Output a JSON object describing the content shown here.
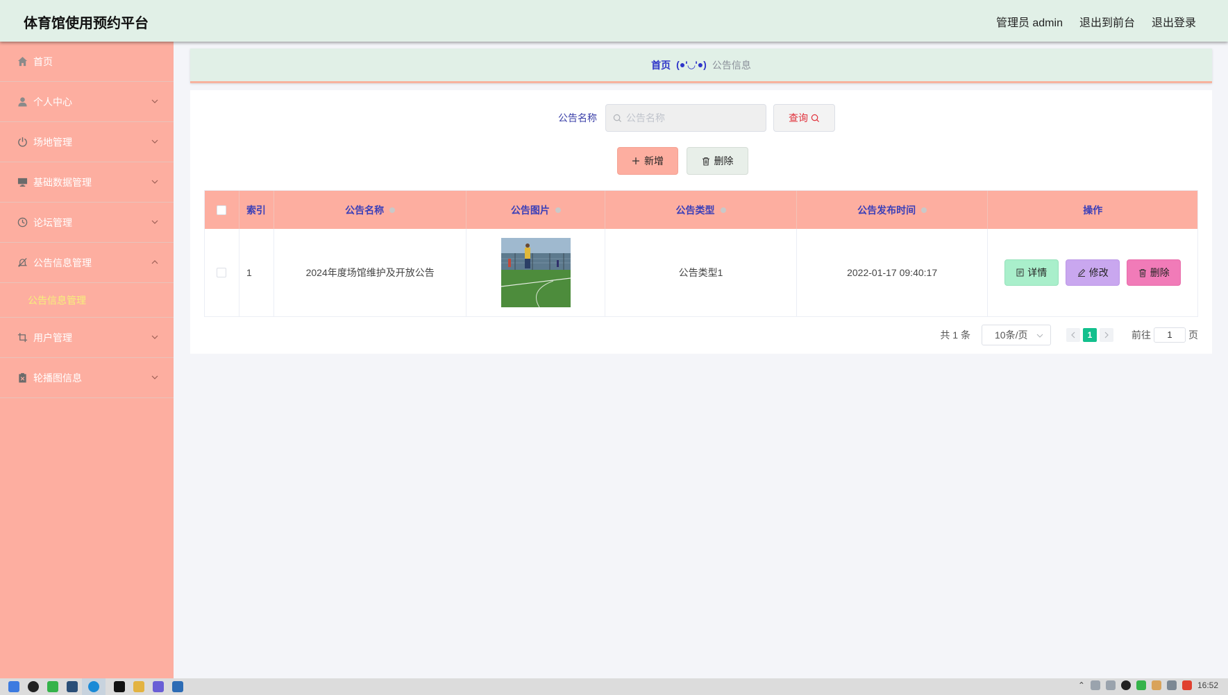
{
  "header": {
    "app_title": "体育馆使用预约平台",
    "admin_label": "管理员 admin",
    "to_frontend": "退出到前台",
    "logout": "退出登录"
  },
  "sidebar": {
    "items": [
      {
        "label": "首页",
        "icon": "home-icon"
      },
      {
        "label": "个人中心",
        "icon": "user-icon"
      },
      {
        "label": "场地管理",
        "icon": "power-icon"
      },
      {
        "label": "基础数据管理",
        "icon": "monitor-icon"
      },
      {
        "label": "论坛管理",
        "icon": "clock-icon"
      },
      {
        "label": "公告信息管理",
        "icon": "bell-off-icon"
      },
      {
        "label": "用户管理",
        "icon": "crop-icon"
      },
      {
        "label": "轮播图信息",
        "icon": "clipboard-icon"
      }
    ],
    "active_sub": "公告信息管理"
  },
  "breadcrumb": {
    "home": "首页",
    "emoji": "(●'◡'●)",
    "current": "公告信息"
  },
  "search": {
    "label": "公告名称",
    "placeholder": "公告名称",
    "query_label": "查询"
  },
  "actions": {
    "add_label": "新增",
    "delete_label": "删除"
  },
  "table": {
    "columns": [
      "索引",
      "公告名称",
      "公告图片",
      "公告类型",
      "公告发布时间",
      "操作"
    ],
    "rows": [
      {
        "index": "1",
        "name": "2024年度场馆维护及开放公告",
        "type": "公告类型1",
        "time": "2022-01-17 09:40:17"
      }
    ],
    "op_detail": "详情",
    "op_edit": "修改",
    "op_delete": "删除"
  },
  "pagination": {
    "total": "共 1 条",
    "page_size": "10条/页",
    "current_page": "1",
    "goto_label": "前往",
    "goto_value": "1",
    "page_suffix": "页"
  },
  "taskbar": {
    "clock": "16:52"
  },
  "colors": {
    "sidebar": "#fdaea0",
    "header": "#e1f0e7",
    "accent_blue": "#2f35c9",
    "pager_active": "#13c08d"
  }
}
